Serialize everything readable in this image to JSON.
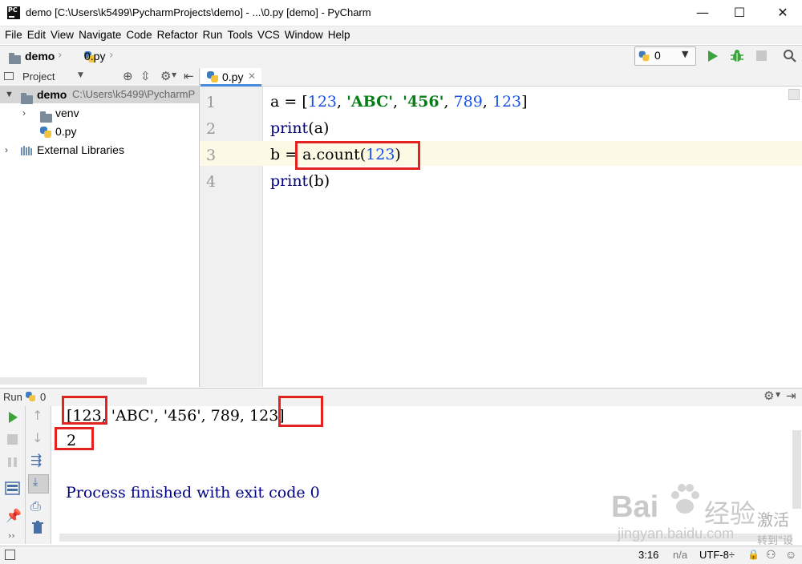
{
  "window": {
    "title": "demo [C:\\Users\\k5499\\PycharmProjects\\demo] - ...\\0.py [demo] - PyCharm",
    "app_icon_text": "PC",
    "minimize": "—",
    "maximize": "☐",
    "close": "✕"
  },
  "menu": [
    "File",
    "Edit",
    "View",
    "Navigate",
    "Code",
    "Refactor",
    "Run",
    "Tools",
    "VCS",
    "Window",
    "Help"
  ],
  "navbar": {
    "project": "demo",
    "file": "0.py",
    "run_config": "0"
  },
  "project_panel": {
    "header": "Project",
    "root_name": "demo",
    "root_path": "C:\\Users\\k5499\\PycharmP",
    "items": [
      {
        "label": "venv"
      },
      {
        "label": "0.py"
      },
      {
        "label": "External Libraries"
      }
    ]
  },
  "editor": {
    "tab": "0.py",
    "line_numbers": [
      "1",
      "2",
      "3",
      "4"
    ],
    "lines": [
      {
        "t1": "a = [",
        "n1": "123",
        "c1": ", ",
        "s1": "'ABC'",
        "c2": ", ",
        "s2": "'456'",
        "c3": ", ",
        "n2": "789",
        "c4": ", ",
        "n3": "123",
        "c5": "]"
      },
      {
        "fn": "print",
        "arg": "(a)"
      },
      {
        "pre": "b = ",
        "call": "a.count(",
        "n": "123",
        "post": ")"
      },
      {
        "fn": "print",
        "arg": "(b)"
      }
    ]
  },
  "run_panel": {
    "label": "Run",
    "config": "0",
    "output_line1": {
      "p1": "[123",
      "p2": ", 'ABC', '456', 789, ",
      "p3": "123]"
    },
    "output_line2": "2",
    "output_line3": "Process finished with exit code 0"
  },
  "statusbar": {
    "position": "3:16",
    "na": "n/a",
    "encoding": "UTF-8÷"
  },
  "watermark": {
    "brand": "Bai",
    "brand_cn": "经验",
    "url": "jingyan.baidu.com",
    "activate": "激活",
    "goto": "转到\"设"
  },
  "colors": {
    "accent": "#4a89dc",
    "highlight_box": "#e52222",
    "number": "#1750eb",
    "string": "#067d17",
    "builtin": "#000080",
    "exit_text": "#000080"
  }
}
